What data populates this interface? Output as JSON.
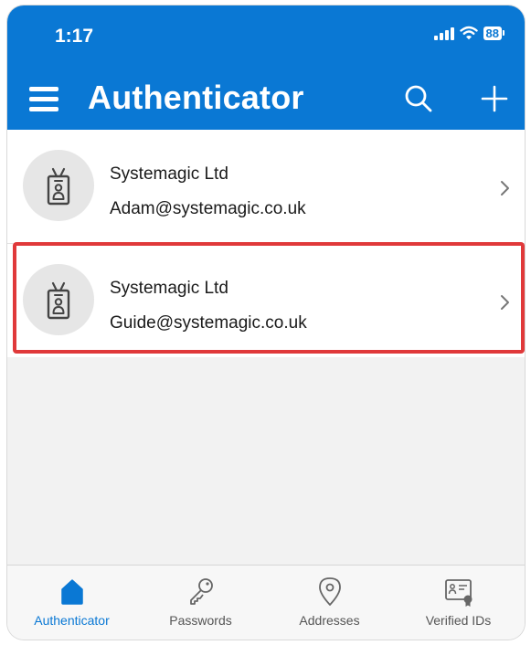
{
  "status_bar": {
    "time": "1:17",
    "battery": "88"
  },
  "header": {
    "title": "Authenticator"
  },
  "accounts": [
    {
      "org": "Systemagic Ltd",
      "email": "Adam@systemagic.co.uk"
    },
    {
      "org": "Systemagic Ltd",
      "email": "Guide@systemagic.co.uk"
    }
  ],
  "tabs": [
    {
      "label": "Authenticator",
      "icon": "home-icon",
      "active": true
    },
    {
      "label": "Passwords",
      "icon": "key-icon",
      "active": false
    },
    {
      "label": "Addresses",
      "icon": "location-pin-icon",
      "active": false
    },
    {
      "label": "Verified IDs",
      "icon": "id-card-icon",
      "active": false
    }
  ],
  "colors": {
    "brand": "#0a78d4",
    "highlight": "#e0393a"
  }
}
